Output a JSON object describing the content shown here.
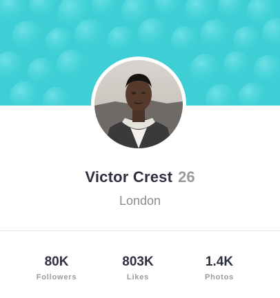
{
  "profile": {
    "name": "Victor Crest",
    "age": "26",
    "location": "London"
  },
  "stats": [
    {
      "value": "80K",
      "label": "Followers"
    },
    {
      "value": "803K",
      "label": "Likes"
    },
    {
      "value": "1.4K",
      "label": "Photos"
    }
  ],
  "colors": {
    "banner": "#3ecfd6",
    "name": "#2e3040",
    "muted": "#9a9a9a"
  }
}
